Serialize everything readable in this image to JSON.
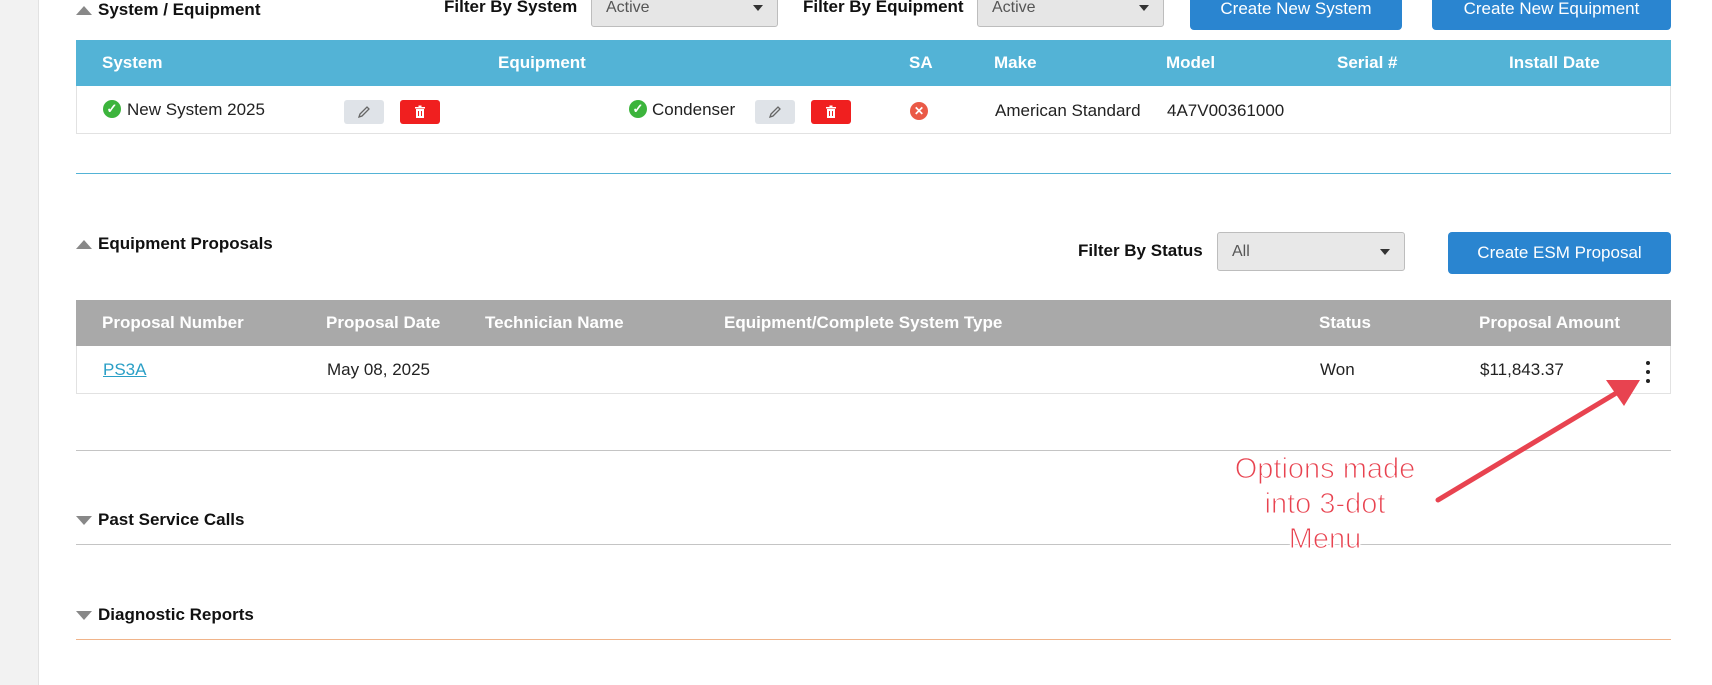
{
  "system_section": {
    "title": "System / Equipment",
    "filter_system_label": "Filter By System",
    "filter_system_value": "Active",
    "filter_equipment_label": "Filter By Equipment",
    "filter_equipment_value": "Active",
    "create_system_button": "Create New System",
    "create_equipment_button": "Create New Equipment",
    "columns": [
      "System",
      "Equipment",
      "SA",
      "Make",
      "Model",
      "Serial #",
      "Install Date"
    ],
    "row": {
      "system": "New System 2025",
      "equipment": "Condenser",
      "make": "American Standard",
      "model": "4A7V00361000",
      "serial": "",
      "install_date": ""
    }
  },
  "proposals_section": {
    "title": "Equipment Proposals",
    "filter_status_label": "Filter By Status",
    "filter_status_value": "All",
    "create_button": "Create ESM Proposal",
    "columns": [
      "Proposal Number",
      "Proposal Date",
      "Technician Name",
      "Equipment/Complete System Type",
      "Status",
      "Proposal Amount"
    ],
    "row": {
      "number": "PS3A",
      "date": "May 08, 2025",
      "technician": "",
      "type": "",
      "status": "Won",
      "amount": "$11,843.37"
    }
  },
  "past_calls_section": {
    "title": "Past Service Calls"
  },
  "diagnostic_section": {
    "title": "Diagnostic Reports"
  },
  "annotation": {
    "lines": [
      "Options made",
      "into 3-dot",
      "Menu"
    ],
    "color": "#e84350"
  },
  "colors": {
    "accent_blue": "#2a85d0",
    "table_header_blue": "#53b3d6",
    "table_header_grey": "#a9a9a9",
    "delete_red": "#f01f1f",
    "success_green": "#3cb43c",
    "diagnostic_divider": "#f0b48a"
  }
}
